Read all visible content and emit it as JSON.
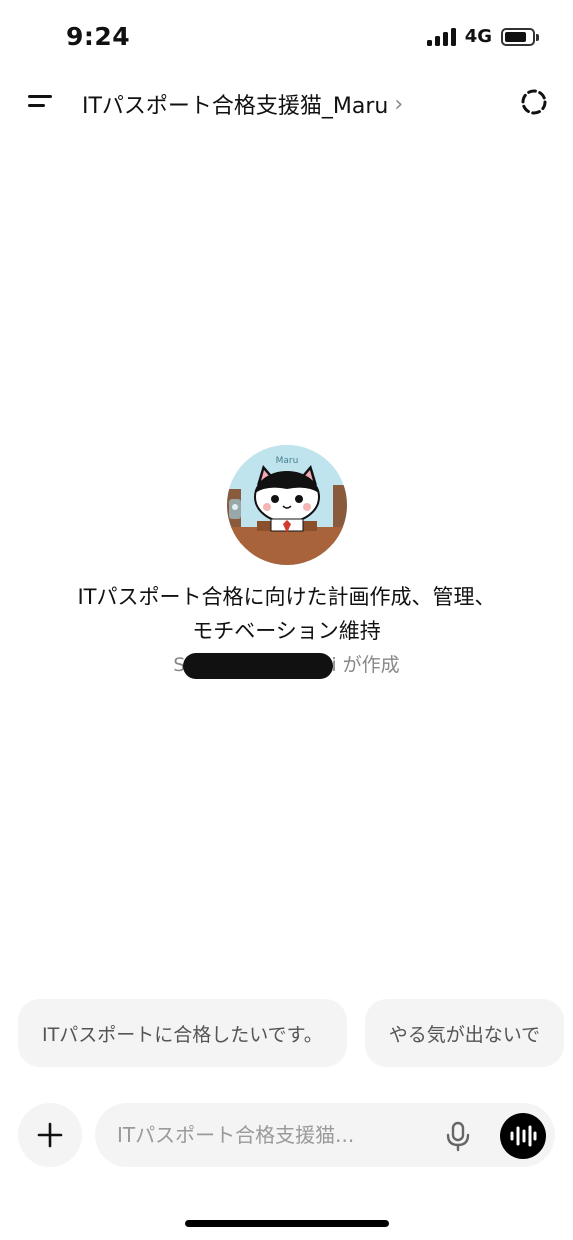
{
  "status_bar": {
    "time": "9:24",
    "network": "4G",
    "signal_bars": 4,
    "battery_level": 0.8
  },
  "header": {
    "title": "ITパスポート合格支援猫_Maru",
    "chevron": "›"
  },
  "gpt": {
    "avatar_label": "Maru",
    "description_line1": "ITパスポート合格に向けた計画作成、管理、",
    "description_line2": "モチベーション維持",
    "creator_prefix": "S",
    "creator_suffix": "i が作成"
  },
  "suggestions": [
    {
      "label": "ITパスポートに合格したいです。"
    },
    {
      "label": "やる気が出ないで"
    }
  ],
  "composer": {
    "placeholder": "ITパスポート合格支援猫..."
  },
  "icons": {
    "menu": "menu-icon",
    "new_chat": "new-chat-icon",
    "plus": "plus-icon",
    "mic": "mic-icon",
    "voice": "voice-waveform-icon"
  }
}
